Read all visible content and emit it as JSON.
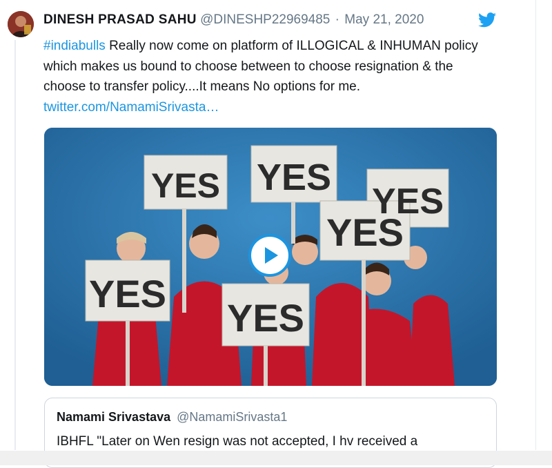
{
  "tweet": {
    "display_name": "DINESH PRASAD SAHU",
    "handle": "@DINESHP22969485",
    "separator": "·",
    "date": "May 21, 2020",
    "hashtag": "#indiabulls",
    "text": " Really now come on platform of ILLOGICAL & INHUMAN policy which makes us bound to choose between to choose resignation & the choose to transfer policy....It means No options for me. ",
    "link": "twitter.com/NamamiSrivasta…"
  },
  "media": {
    "type": "video",
    "signs": [
      "YES",
      "YES",
      "YES",
      "YES",
      "YES",
      "YES"
    ],
    "play_icon": "play-icon"
  },
  "quoted_tweet": {
    "display_name": "Namami Srivastava",
    "handle": "@NamamiSrivasta1",
    "text": "IBHFL \"Later on Wen resign was not accepted, I hv received a"
  },
  "colors": {
    "link": "#1b95e0",
    "text": "#14171a",
    "secondary": "#657786",
    "video_background": "#2e7ab4"
  }
}
